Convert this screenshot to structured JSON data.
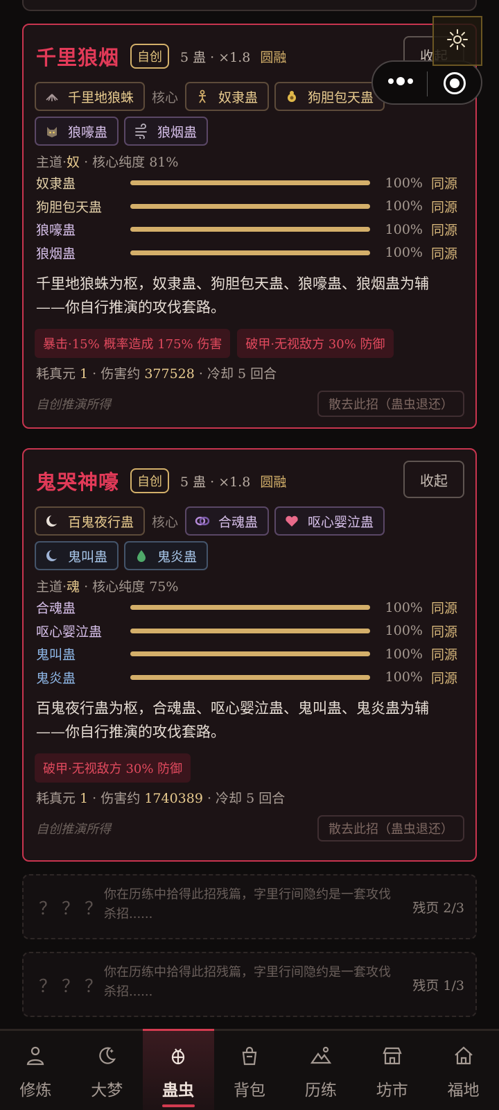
{
  "cards": [
    {
      "title": "千里狼烟",
      "badge": "自创",
      "meta": "5 蛊 · ×1.8",
      "rank": "圆融",
      "collapse": "收起",
      "core_label": "核心",
      "core": {
        "name": "千里地狼蛛",
        "icon": "spider-fan-icon"
      },
      "aux": [
        {
          "name": "奴隶蛊",
          "icon": "puppet-icon",
          "tone": "gold"
        },
        {
          "name": "狗胆包天蛊",
          "icon": "gourd-icon",
          "tone": "gold"
        },
        {
          "name": "狼嚎蛊",
          "icon": "wolf-icon",
          "tone": "purple"
        },
        {
          "name": "狼烟蛊",
          "icon": "wind-icon",
          "tone": "purple"
        }
      ],
      "path_prefix": "主道·",
      "path": "奴",
      "purity": " · 核心纯度 81%",
      "bars": [
        {
          "name": "奴隶蛊",
          "value": 100,
          "pct": "100%",
          "src": "同源",
          "color": "#e2cfa8"
        },
        {
          "name": "狗胆包天蛊",
          "value": 100,
          "pct": "100%",
          "src": "同源",
          "color": "#e2cfa8"
        },
        {
          "name": "狼嚎蛊",
          "value": 100,
          "pct": "100%",
          "src": "同源",
          "color": "#d7c0ea"
        },
        {
          "name": "狼烟蛊",
          "value": 100,
          "pct": "100%",
          "src": "同源",
          "color": "#d7c0ea"
        }
      ],
      "desc1": "千里地狼蛛为枢，奴隶蛊、狗胆包天蛊、狼嚎蛊、狼烟蛊为辅",
      "desc2": "——你自行推演的攻伐套路。",
      "effects": [
        "暴击·15% 概率造成 175% 伤害",
        "破甲·无视敌方 30% 防御"
      ],
      "cost_a": "耗真元 ",
      "cost_b": "1",
      "cost_c": " · 伤害约 ",
      "cost_d": "377528",
      "cost_e": " · 冷却 5 回合",
      "origin": "自创推演所得",
      "disperse": "散去此招（蛊虫退还）"
    },
    {
      "title": "鬼哭神嚎",
      "badge": "自创",
      "meta": "5 蛊 · ×1.8",
      "rank": "圆融",
      "collapse": "收起",
      "core_label": "核心",
      "core": {
        "name": "百鬼夜行蛊",
        "icon": "crescent-moon-icon"
      },
      "aux": [
        {
          "name": "合魂蛊",
          "icon": "ring-icon",
          "tone": "purple"
        },
        {
          "name": "呕心婴泣蛊",
          "icon": "heart-icon",
          "tone": "purple"
        },
        {
          "name": "鬼叫蛊",
          "icon": "moon-icon",
          "tone": "blue"
        },
        {
          "name": "鬼炎蛊",
          "icon": "flame-drop-icon",
          "tone": "blue"
        }
      ],
      "path_prefix": "主道·",
      "path": "魂",
      "purity": " · 核心纯度 75%",
      "bars": [
        {
          "name": "合魂蛊",
          "value": 100,
          "pct": "100%",
          "src": "同源",
          "color": "#d7c0ea"
        },
        {
          "name": "呕心婴泣蛊",
          "value": 100,
          "pct": "100%",
          "src": "同源",
          "color": "#d7c0ea"
        },
        {
          "name": "鬼叫蛊",
          "value": 100,
          "pct": "100%",
          "src": "同源",
          "color": "#8fb8e8"
        },
        {
          "name": "鬼炎蛊",
          "value": 100,
          "pct": "100%",
          "src": "同源",
          "color": "#8fb8e8"
        }
      ],
      "desc1": "百鬼夜行蛊为枢，合魂蛊、呕心婴泣蛊、鬼叫蛊、鬼炎蛊为辅",
      "desc2": "——你自行推演的攻伐套路。",
      "effects": [
        "破甲·无视敌方 30% 防御"
      ],
      "cost_a": "耗真元 ",
      "cost_b": "1",
      "cost_c": " · 伤害约 ",
      "cost_d": "1740389",
      "cost_e": " · 冷却 5 回合",
      "origin": "自创推演所得",
      "disperse": "散去此招（蛊虫退还）"
    }
  ],
  "fragments": [
    {
      "mask": "？？？",
      "text": "你在历练中拾得此招残篇，字里行间隐约是一套攻伐杀招......",
      "page": "残页 2/3"
    },
    {
      "mask": "？？？",
      "text": "你在历练中拾得此招残篇，字里行间隐约是一套攻伐杀招......",
      "page": "残页 1/3"
    }
  ],
  "tabs": [
    {
      "label": "修炼",
      "icon": "person-icon"
    },
    {
      "label": "大梦",
      "icon": "moon-icon"
    },
    {
      "label": "蛊虫",
      "icon": "gu-bug-icon",
      "active": true
    },
    {
      "label": "背包",
      "icon": "bag-icon"
    },
    {
      "label": "历练",
      "icon": "mountain-icon"
    },
    {
      "label": "坊市",
      "icon": "shop-icon"
    },
    {
      "label": "福地",
      "icon": "home-icon"
    }
  ],
  "colors": {
    "accent": "#e23a58",
    "gold": "#d4af6a"
  }
}
